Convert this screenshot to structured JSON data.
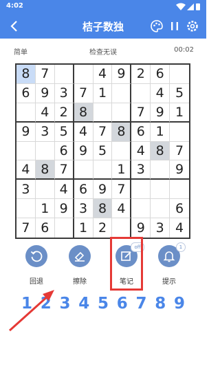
{
  "status_bar": {
    "time": "4:02"
  },
  "app_bar": {
    "title": "桔子数独",
    "back_icon": "back-arrow-icon",
    "right_icons": [
      "palette-icon",
      "pause-icon",
      "settings-icon"
    ]
  },
  "info_bar": {
    "difficulty": "简单",
    "check_text": "检查无误",
    "timer": "00:02"
  },
  "board": {
    "rows": [
      [
        "8",
        "7",
        "",
        "",
        "4",
        "9",
        "2",
        "6",
        ""
      ],
      [
        "6",
        "9",
        "3",
        "7",
        "1",
        "",
        "",
        "4",
        "5"
      ],
      [
        "",
        "4",
        "2",
        "8",
        "",
        "",
        "7",
        "9",
        "1"
      ],
      [
        "9",
        "3",
        "5",
        "4",
        "7",
        "8",
        "6",
        "1",
        ""
      ],
      [
        "",
        "",
        "6",
        "9",
        "5",
        "",
        "4",
        "8",
        "7"
      ],
      [
        "4",
        "8",
        "7",
        "",
        "",
        "1",
        "3",
        "",
        "9"
      ],
      [
        "3",
        "",
        "4",
        "6",
        "9",
        "7",
        "",
        "",
        ""
      ],
      [
        "",
        "1",
        "9",
        "3",
        "8",
        "4",
        "",
        "",
        "6"
      ],
      [
        "7",
        "6",
        "",
        "1",
        "2",
        "",
        "9",
        "3",
        "4"
      ]
    ],
    "selected_cell": [
      0,
      0
    ],
    "highlighted_cells": [
      [
        2,
        3
      ],
      [
        3,
        5
      ],
      [
        4,
        7
      ],
      [
        5,
        1
      ],
      [
        7,
        4
      ]
    ]
  },
  "controls": {
    "undo_label": "回退",
    "erase_label": "擦除",
    "notes_label": "笔记",
    "notes_badge": "off",
    "hint_label": "提示",
    "hint_badge": "1"
  },
  "numpad": [
    "1",
    "2",
    "3",
    "4",
    "5",
    "6",
    "7",
    "8",
    "9"
  ],
  "colors": {
    "primary": "#4a86e8",
    "button": "#6b8fc7",
    "annotation": "#e53935"
  }
}
